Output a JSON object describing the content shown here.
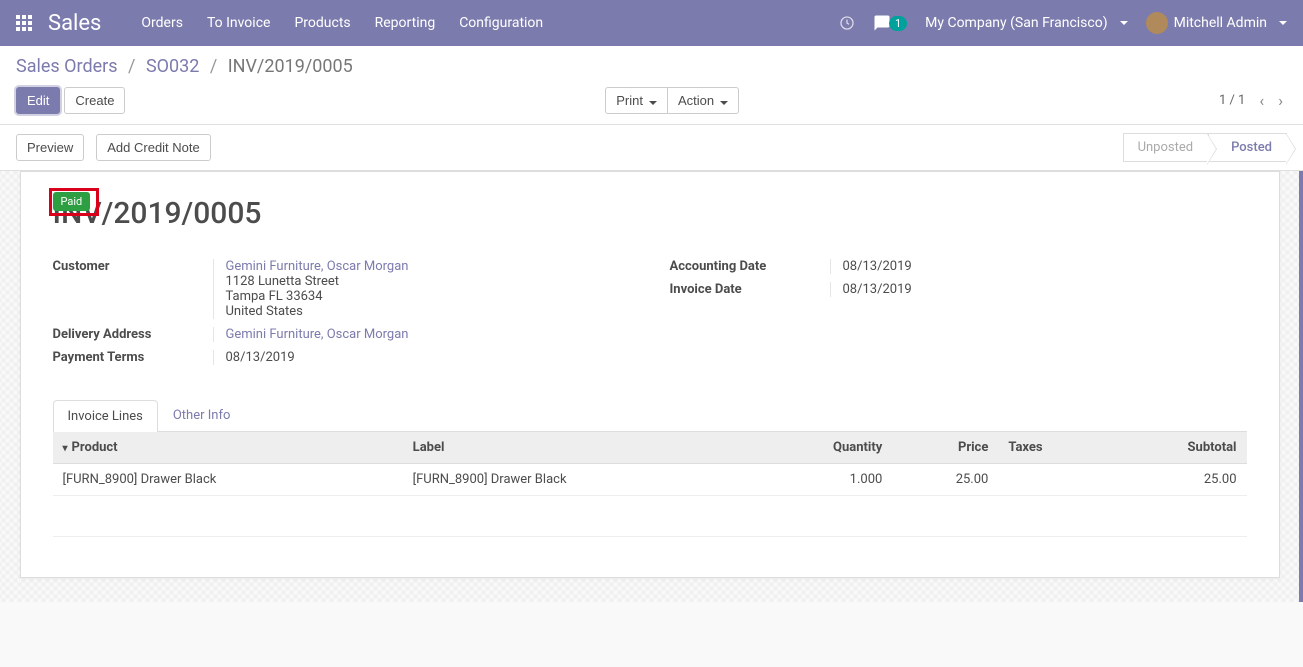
{
  "topnav": {
    "brand": "Sales",
    "menu": [
      "Orders",
      "To Invoice",
      "Products",
      "Reporting",
      "Configuration"
    ],
    "chat_count": "1",
    "company": "My Company (San Francisco)",
    "user": "Mitchell Admin"
  },
  "breadcrumb": {
    "root": "Sales Orders",
    "parent": "SO032",
    "current": "INV/2019/0005"
  },
  "cp": {
    "edit": "Edit",
    "create": "Create",
    "print": "Print",
    "action": "Action",
    "pager": "1 / 1"
  },
  "statusbar": {
    "preview": "Preview",
    "credit_note": "Add Credit Note",
    "unposted": "Unposted",
    "posted": "Posted"
  },
  "invoice": {
    "paid_label": "Paid",
    "title": "INV/2019/0005",
    "labels": {
      "customer": "Customer",
      "delivery_address": "Delivery Address",
      "payment_terms": "Payment Terms",
      "accounting_date": "Accounting Date",
      "invoice_date": "Invoice Date"
    },
    "customer_name": "Gemini Furniture, Oscar Morgan",
    "customer_addr1": "1128 Lunetta Street",
    "customer_addr2": "Tampa FL 33634",
    "customer_addr3": "United States",
    "delivery_address": "Gemini Furniture, Oscar Morgan",
    "payment_terms": "08/13/2019",
    "accounting_date": "08/13/2019",
    "invoice_date": "08/13/2019"
  },
  "tabs": {
    "invoice_lines": "Invoice Lines",
    "other_info": "Other Info"
  },
  "table": {
    "headers": {
      "product": "Product",
      "label": "Label",
      "quantity": "Quantity",
      "price": "Price",
      "taxes": "Taxes",
      "subtotal": "Subtotal"
    },
    "rows": [
      {
        "product": "[FURN_8900] Drawer Black",
        "label": "[FURN_8900] Drawer Black",
        "quantity": "1.000",
        "price": "25.00",
        "taxes": "",
        "subtotal": "25.00"
      }
    ]
  }
}
